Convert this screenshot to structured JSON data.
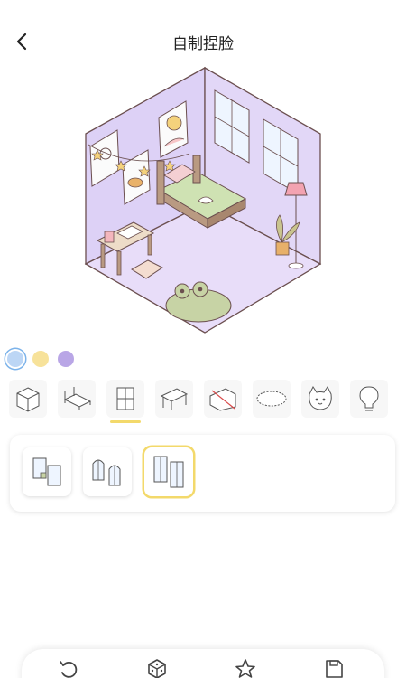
{
  "header": {
    "title": "自制捏脸",
    "back_icon": "chevron-left-icon"
  },
  "colors": {
    "wall": "#ddd1f6",
    "floor": "#e6dcf8",
    "selected_underline": "#f3d96b",
    "swatches": [
      "#bcd6f5",
      "#f7e29a",
      "#b9a6e6"
    ]
  },
  "swatches": [
    {
      "name": "blue",
      "color": "#bcd6f5",
      "selected": true
    },
    {
      "name": "yellow",
      "color": "#f7e29a",
      "selected": false
    },
    {
      "name": "purple",
      "color": "#b9a6e6",
      "selected": false
    }
  ],
  "categories": [
    {
      "icon": "cube-icon",
      "selected": false
    },
    {
      "icon": "bed-icon",
      "selected": false
    },
    {
      "icon": "window-icon",
      "selected": true
    },
    {
      "icon": "table-icon",
      "selected": false
    },
    {
      "icon": "no-wallpaper-icon",
      "selected": false
    },
    {
      "icon": "rug-icon",
      "selected": false
    },
    {
      "icon": "cat-face-icon",
      "selected": false
    },
    {
      "icon": "lightbulb-icon",
      "selected": false
    }
  ],
  "window_options": [
    {
      "icon": "window-with-plant-icon",
      "selected": false
    },
    {
      "icon": "arched-windows-icon",
      "selected": false
    },
    {
      "icon": "tall-windows-icon",
      "selected": true
    }
  ],
  "toolbar": [
    {
      "icon": "undo-icon"
    },
    {
      "icon": "dice-icon"
    },
    {
      "icon": "star-icon"
    },
    {
      "icon": "save-icon"
    }
  ]
}
